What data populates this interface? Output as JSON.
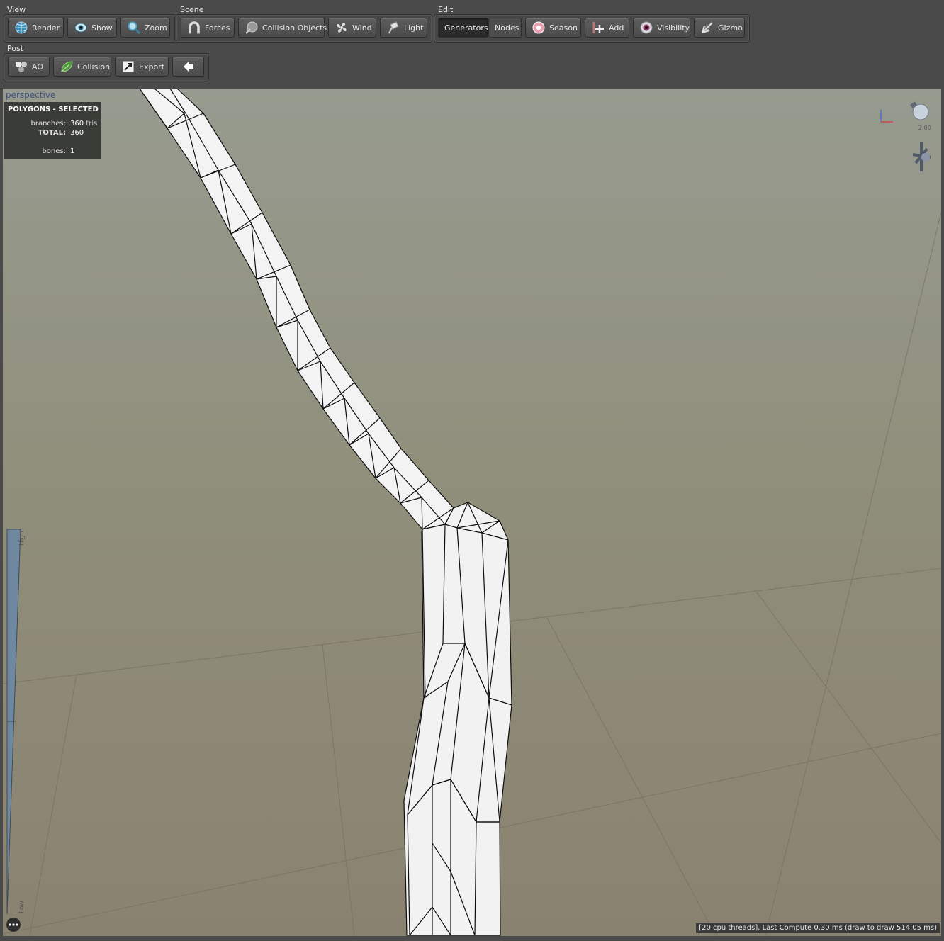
{
  "toolbar": {
    "view": {
      "label": "View",
      "buttons": [
        {
          "label": "Render",
          "icon": "globe-icon"
        },
        {
          "label": "Show",
          "icon": "eye-icon"
        },
        {
          "label": "Zoom",
          "icon": "magnifier-icon"
        }
      ]
    },
    "scene": {
      "label": "Scene",
      "buttons": [
        {
          "label": "Forces",
          "icon": "magnet-icon"
        },
        {
          "label": "Collision Objects",
          "icon": "sphere-icon"
        },
        {
          "label": "Wind",
          "icon": "fan-icon"
        },
        {
          "label": "Light",
          "icon": "spotlight-icon"
        }
      ]
    },
    "edit": {
      "label": "Edit",
      "buttons": [
        {
          "label": "Generators",
          "active": true
        },
        {
          "label": "Nodes"
        },
        {
          "label": "Season",
          "icon": "season-icon"
        },
        {
          "label": "Add",
          "icon": "add-icon"
        },
        {
          "label": "Visibility",
          "icon": "visibility-eye-icon"
        },
        {
          "label": "Gizmo",
          "icon": "gizmo-icon"
        }
      ]
    },
    "post": {
      "label": "Post",
      "buttons": [
        {
          "label": "AO",
          "icon": "ao-icon"
        },
        {
          "label": "Collision",
          "icon": "leaf-icon"
        },
        {
          "label": "Export",
          "icon": "export-icon"
        },
        {
          "label": "",
          "icon": "back-arrow-icon"
        }
      ]
    }
  },
  "viewport": {
    "camera_label": "perspective",
    "stats": {
      "header": "POLYGONS - SELECTED",
      "branches_label": "branches:",
      "branches_value": "360",
      "branches_unit": "tris",
      "total_label": "TOTAL:",
      "total_value": "360",
      "bones_label": "bones:",
      "bones_value": "1"
    },
    "light_intensity": "2.00",
    "lod_high_label": "High",
    "lod_low_label": "Low",
    "status": "[20 cpu threads], Last Compute 0.30 ms (draw to draw 514.05 ms)"
  },
  "colors": {
    "toolbar_bg": "#4a4a4a",
    "active_button": "#2b2b2b",
    "camera_label": "#3d4f86",
    "mesh_fill": "#f4f4f4",
    "wire": "#111111"
  }
}
